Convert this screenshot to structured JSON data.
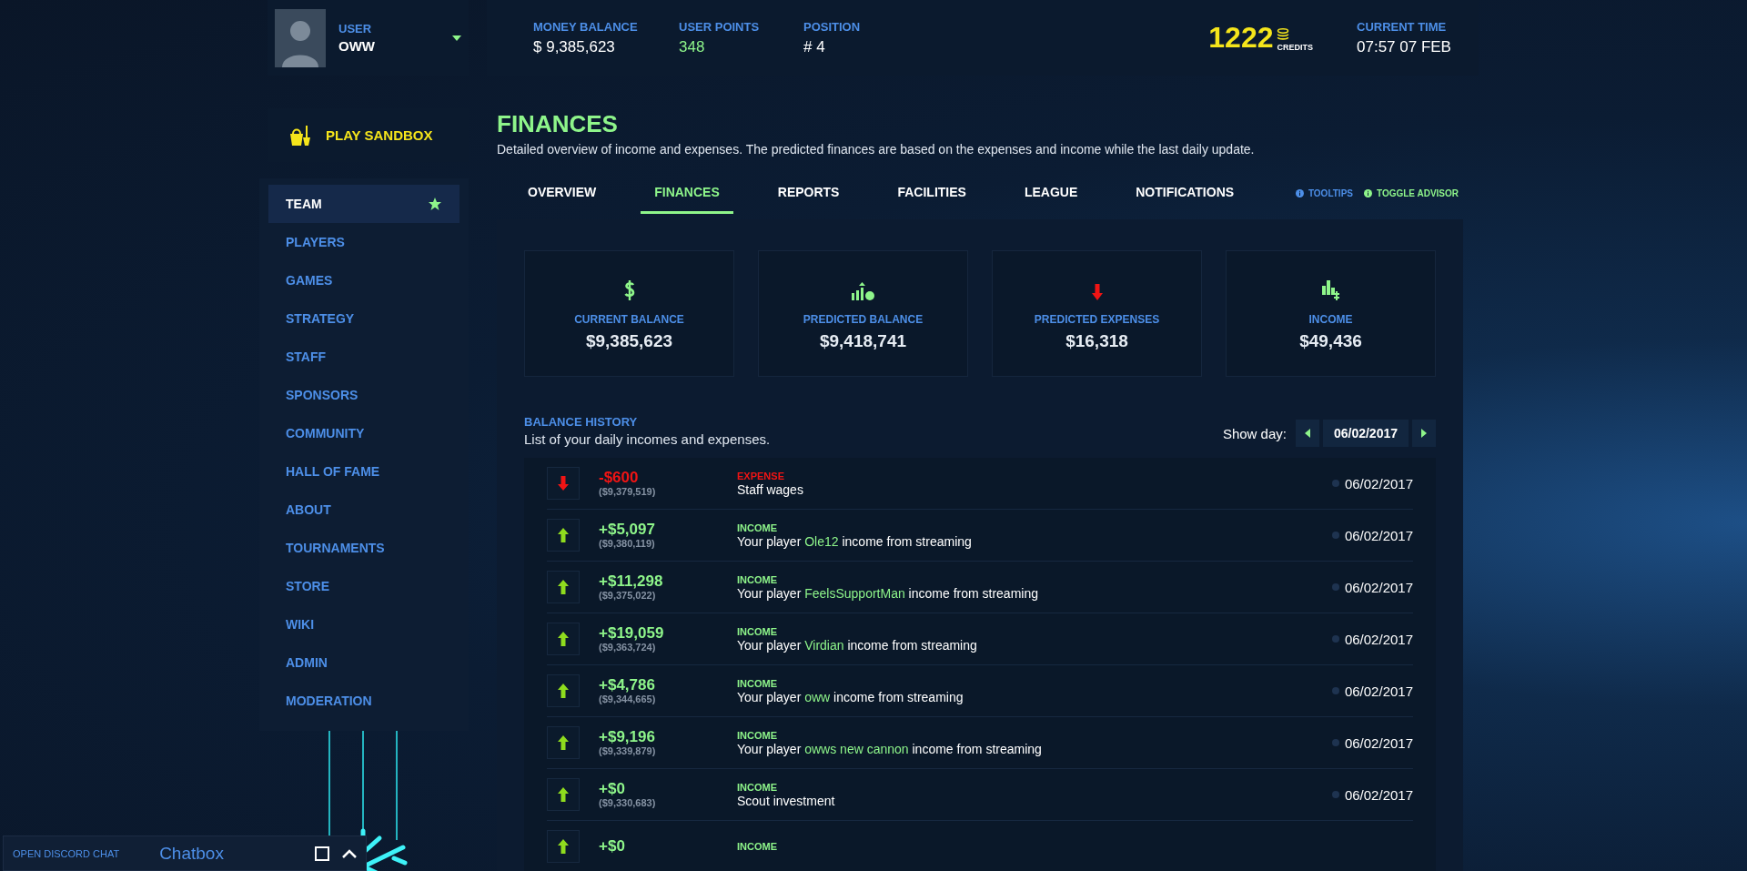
{
  "user": {
    "label": "USER",
    "name": "OWW"
  },
  "stats": [
    {
      "kind": "money",
      "label": "MONEY BALANCE",
      "value": "$ 9,385,623"
    },
    {
      "kind": "points",
      "label": "USER POINTS",
      "value": "348"
    },
    {
      "kind": "position",
      "label": "POSITION",
      "value": "# 4"
    }
  ],
  "credits": {
    "value": "1222",
    "label": "CREDITS"
  },
  "time": {
    "label": "CURRENT TIME",
    "value": "07:57 07 FEB"
  },
  "sandbox": {
    "label": "PLAY SANDBOX"
  },
  "nav": [
    {
      "label": "TEAM",
      "selected": true,
      "starred": true
    },
    {
      "label": "PLAYERS",
      "selected": false,
      "starred": false
    },
    {
      "label": "GAMES",
      "selected": false,
      "starred": false
    },
    {
      "label": "STRATEGY",
      "selected": false,
      "starred": false
    },
    {
      "label": "STAFF",
      "selected": false,
      "starred": false
    },
    {
      "label": "SPONSORS",
      "selected": false,
      "starred": false
    },
    {
      "label": "COMMUNITY",
      "selected": false,
      "starred": false
    },
    {
      "label": "HALL OF FAME",
      "selected": false,
      "starred": false
    },
    {
      "label": "ABOUT",
      "selected": false,
      "starred": false
    },
    {
      "label": "TOURNAMENTS",
      "selected": false,
      "starred": false
    },
    {
      "label": "STORE",
      "selected": false,
      "starred": false
    },
    {
      "label": "WIKI",
      "selected": false,
      "starred": false
    },
    {
      "label": "ADMIN",
      "selected": false,
      "starred": false
    },
    {
      "label": "MODERATION",
      "selected": false,
      "starred": false
    }
  ],
  "page": {
    "title": "FINANCES",
    "description": "Detailed overview of income and expenses. The predicted finances are based on the expenses and income while the last daily update."
  },
  "tabs": [
    {
      "label": "OVERVIEW",
      "selected": false
    },
    {
      "label": "FINANCES",
      "selected": true
    },
    {
      "label": "REPORTS",
      "selected": false
    },
    {
      "label": "FACILITIES",
      "selected": false
    },
    {
      "label": "LEAGUE",
      "selected": false
    },
    {
      "label": "NOTIFICATIONS",
      "selected": false
    }
  ],
  "helpers": [
    {
      "label": "TOOLTIPS",
      "color": "#4d8fe8"
    },
    {
      "label": "TOGGLE ADVISOR",
      "color": "#8ef58a"
    }
  ],
  "summary_cards": [
    {
      "kind": "balance",
      "label": "CURRENT BALANCE",
      "value": "$9,385,623"
    },
    {
      "kind": "predicted",
      "label": "PREDICTED BALANCE",
      "value": "$9,418,741"
    },
    {
      "kind": "expenses",
      "label": "PREDICTED EXPENSES",
      "value": "$16,318"
    },
    {
      "kind": "income",
      "label": "INCOME",
      "value": "$49,436"
    }
  ],
  "history": {
    "title": "BALANCE HISTORY",
    "subtitle": "List of your daily incomes and expenses.",
    "show_day_label": "Show day:",
    "date": "06/02/2017"
  },
  "transactions": [
    {
      "kind": "expense",
      "amount": "-$600",
      "balance": "($9,379,519)",
      "type": "EXPENSE",
      "description": "Staff wages",
      "date": "06/02/2017"
    },
    {
      "kind": "income",
      "amount": "+$5,097",
      "balance": "($9,380,119)",
      "type": "INCOME",
      "before": "Your player ",
      "player": "Ole12",
      "after": " income from streaming",
      "date": "06/02/2017"
    },
    {
      "kind": "income",
      "amount": "+$11,298",
      "balance": "($9,375,022)",
      "type": "INCOME",
      "before": "Your player ",
      "player": "FeelsSupportMan",
      "after": " income from streaming",
      "date": "06/02/2017"
    },
    {
      "kind": "income",
      "amount": "+$19,059",
      "balance": "($9,363,724)",
      "type": "INCOME",
      "before": "Your player ",
      "player": "Virdian",
      "after": " income from streaming",
      "date": "06/02/2017"
    },
    {
      "kind": "income",
      "amount": "+$4,786",
      "balance": "($9,344,665)",
      "type": "INCOME",
      "before": "Your player ",
      "player": "oww",
      "after": " income from streaming",
      "date": "06/02/2017"
    },
    {
      "kind": "income",
      "amount": "+$9,196",
      "balance": "($9,339,879)",
      "type": "INCOME",
      "before": "Your player ",
      "player": "owws new cannon",
      "after": " income from streaming",
      "date": "06/02/2017"
    },
    {
      "kind": "income",
      "amount": "+$0",
      "balance": "($9,330,683)",
      "type": "INCOME",
      "description": "Scout investment",
      "date": "06/02/2017"
    },
    {
      "kind": "income",
      "amount": "+$0",
      "type": "INCOME"
    }
  ],
  "chat": {
    "link": "OPEN DISCORD CHAT",
    "title": "Chatbox"
  }
}
